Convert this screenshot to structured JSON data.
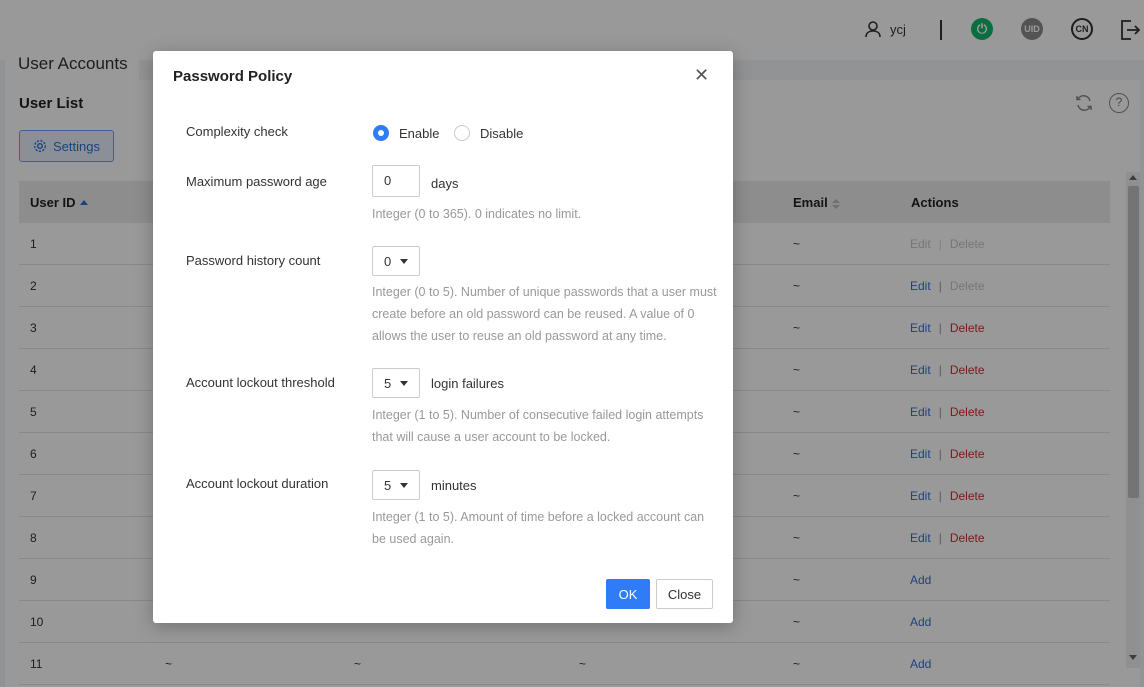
{
  "header": {
    "username": "ycj",
    "uid_badge": "UID",
    "lang_badge": "CN"
  },
  "page": {
    "tab_title": "User Accounts",
    "list_title": "User List",
    "settings_button": "Settings"
  },
  "table": {
    "columns": {
      "user_id": "User ID",
      "email": "Email",
      "actions": "Actions"
    },
    "edit_label": "Edit",
    "delete_label": "Delete",
    "add_label": "Add",
    "rows": [
      {
        "id": "1",
        "email": "~",
        "actions": "edit_disabled"
      },
      {
        "id": "2",
        "email": "~",
        "actions": "edit_only"
      },
      {
        "id": "3",
        "email": "~",
        "actions": "edit_delete"
      },
      {
        "id": "4",
        "email": "~",
        "actions": "edit_delete"
      },
      {
        "id": "5",
        "email": "~",
        "actions": "edit_delete"
      },
      {
        "id": "6",
        "email": "~",
        "actions": "edit_delete"
      },
      {
        "id": "7",
        "email": "~",
        "actions": "edit_delete"
      },
      {
        "id": "8",
        "email": "~",
        "actions": "edit_delete"
      },
      {
        "id": "9",
        "email": "~",
        "actions": "add"
      },
      {
        "id": "10",
        "email": "~",
        "actions": "add"
      },
      {
        "id": "11",
        "email": "~",
        "c1": "~",
        "c2": "~",
        "c3": "~",
        "actions": "add"
      }
    ]
  },
  "modal": {
    "title": "Password Policy",
    "complexity": {
      "label": "Complexity check",
      "enable": "Enable",
      "disable": "Disable",
      "selected": "Enable"
    },
    "max_age": {
      "label": "Maximum password age",
      "value": "0",
      "unit": "days",
      "hint": "Integer (0 to 365). 0 indicates no limit."
    },
    "history": {
      "label": "Password history count",
      "value": "0",
      "hint": "Integer (0 to 5). Number of unique passwords that a user must create before an old password can be reused. A value of 0 allows the user to reuse an old password at any time."
    },
    "lockout_threshold": {
      "label": "Account lockout threshold",
      "value": "5",
      "unit": "login failures",
      "hint": "Integer (1 to 5). Number of consecutive failed login attempts that will cause a user account to be locked."
    },
    "lockout_duration": {
      "label": "Account lockout duration",
      "value": "5",
      "unit": "minutes",
      "hint": "Integer (1 to 5). Amount of time before a locked account can be used again."
    },
    "ok_button": "OK",
    "close_button": "Close"
  }
}
